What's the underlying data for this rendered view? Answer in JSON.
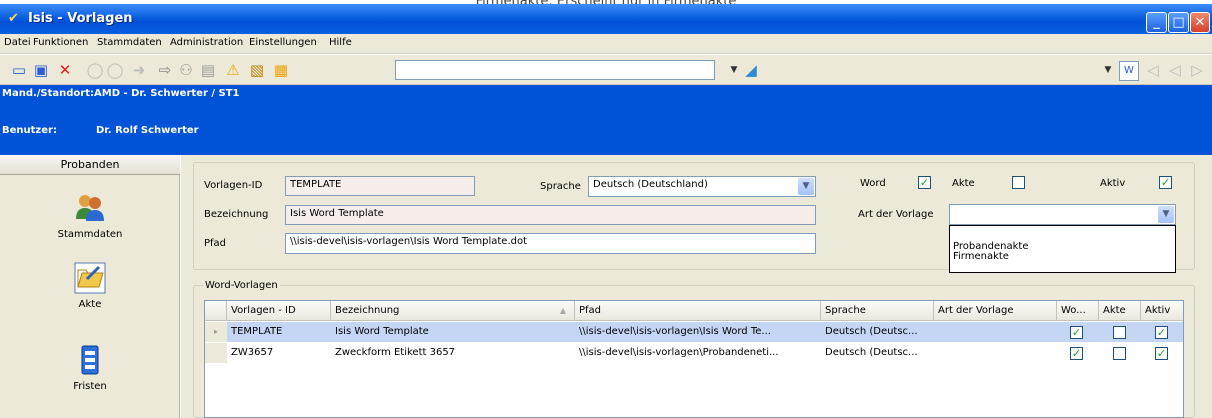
{
  "caption": "Firmenakte: Erscheint nur in Firmenakte",
  "window": {
    "title": "Isis - Vorlagen",
    "controls": [
      "minimize-icon",
      "maximize-icon",
      "close-icon"
    ]
  },
  "menu": [
    "Datei",
    "Funktionen",
    "Stammdaten",
    "Administration",
    "Einstellungen",
    "Hilfe"
  ],
  "status": {
    "mandant_label": "Mand./Standort:",
    "mandant_value": "AMD - Dr. Schwerter / ST1",
    "benutzer_label": "Benutzer:",
    "benutzer_value": "Dr. Rolf Schwerter"
  },
  "sidebar": {
    "header": "Probanden",
    "items": [
      {
        "label": "Stammdaten",
        "icon": "people-icon"
      },
      {
        "label": "Akte",
        "icon": "folder-icon"
      },
      {
        "label": "Fristen",
        "icon": "calendar-icon"
      }
    ]
  },
  "form": {
    "vorlagen_id_label": "Vorlagen-ID",
    "vorlagen_id_value": "TEMPLATE",
    "sprache_label": "Sprache",
    "sprache_value": "Deutsch (Deutschland)",
    "bezeichnung_label": "Bezeichnung",
    "bezeichnung_value": "Isis Word Template",
    "pfad_label": "Pfad",
    "pfad_value": "\\\\isis-devel\\isis-vorlagen\\Isis Word Template.dot",
    "word_label": "Word",
    "word_checked": true,
    "akte_label": "Akte",
    "akte_checked": false,
    "aktiv_label": "Aktiv",
    "aktiv_checked": true,
    "art_label": "Art der Vorlage",
    "art_value": "",
    "art_options": [
      "",
      "Probandenakte",
      "Firmenakte"
    ]
  },
  "grid": {
    "group_label": "Word-Vorlagen",
    "columns": [
      "Vorlagen - ID",
      "Bezeichnung",
      "Pfad",
      "Sprache",
      "Art der Vorlage",
      "Wo...",
      "Akte",
      "Aktiv"
    ],
    "rows": [
      {
        "id": "TEMPLATE",
        "bezeichnung": "Isis Word Template",
        "pfad": "\\\\isis-devel\\isis-vorlagen\\Isis Word Te...",
        "sprache": "Deutsch (Deutsc...",
        "art": "",
        "word": true,
        "akte": false,
        "aktiv": true,
        "selected": true
      },
      {
        "id": "ZW3657",
        "bezeichnung": "Zweckform Etikett 3657",
        "pfad": "\\\\isis-devel\\isis-vorlagen\\Probandeneti...",
        "sprache": "Deutsch (Deutsc...",
        "art": "",
        "word": true,
        "akte": false,
        "aktiv": true,
        "selected": false
      }
    ]
  },
  "colors": {
    "titlebar": "#0a5fe0",
    "bluebar": "#0053d6",
    "chrome": "#ece9d8",
    "selection": "#c5d6f4"
  }
}
